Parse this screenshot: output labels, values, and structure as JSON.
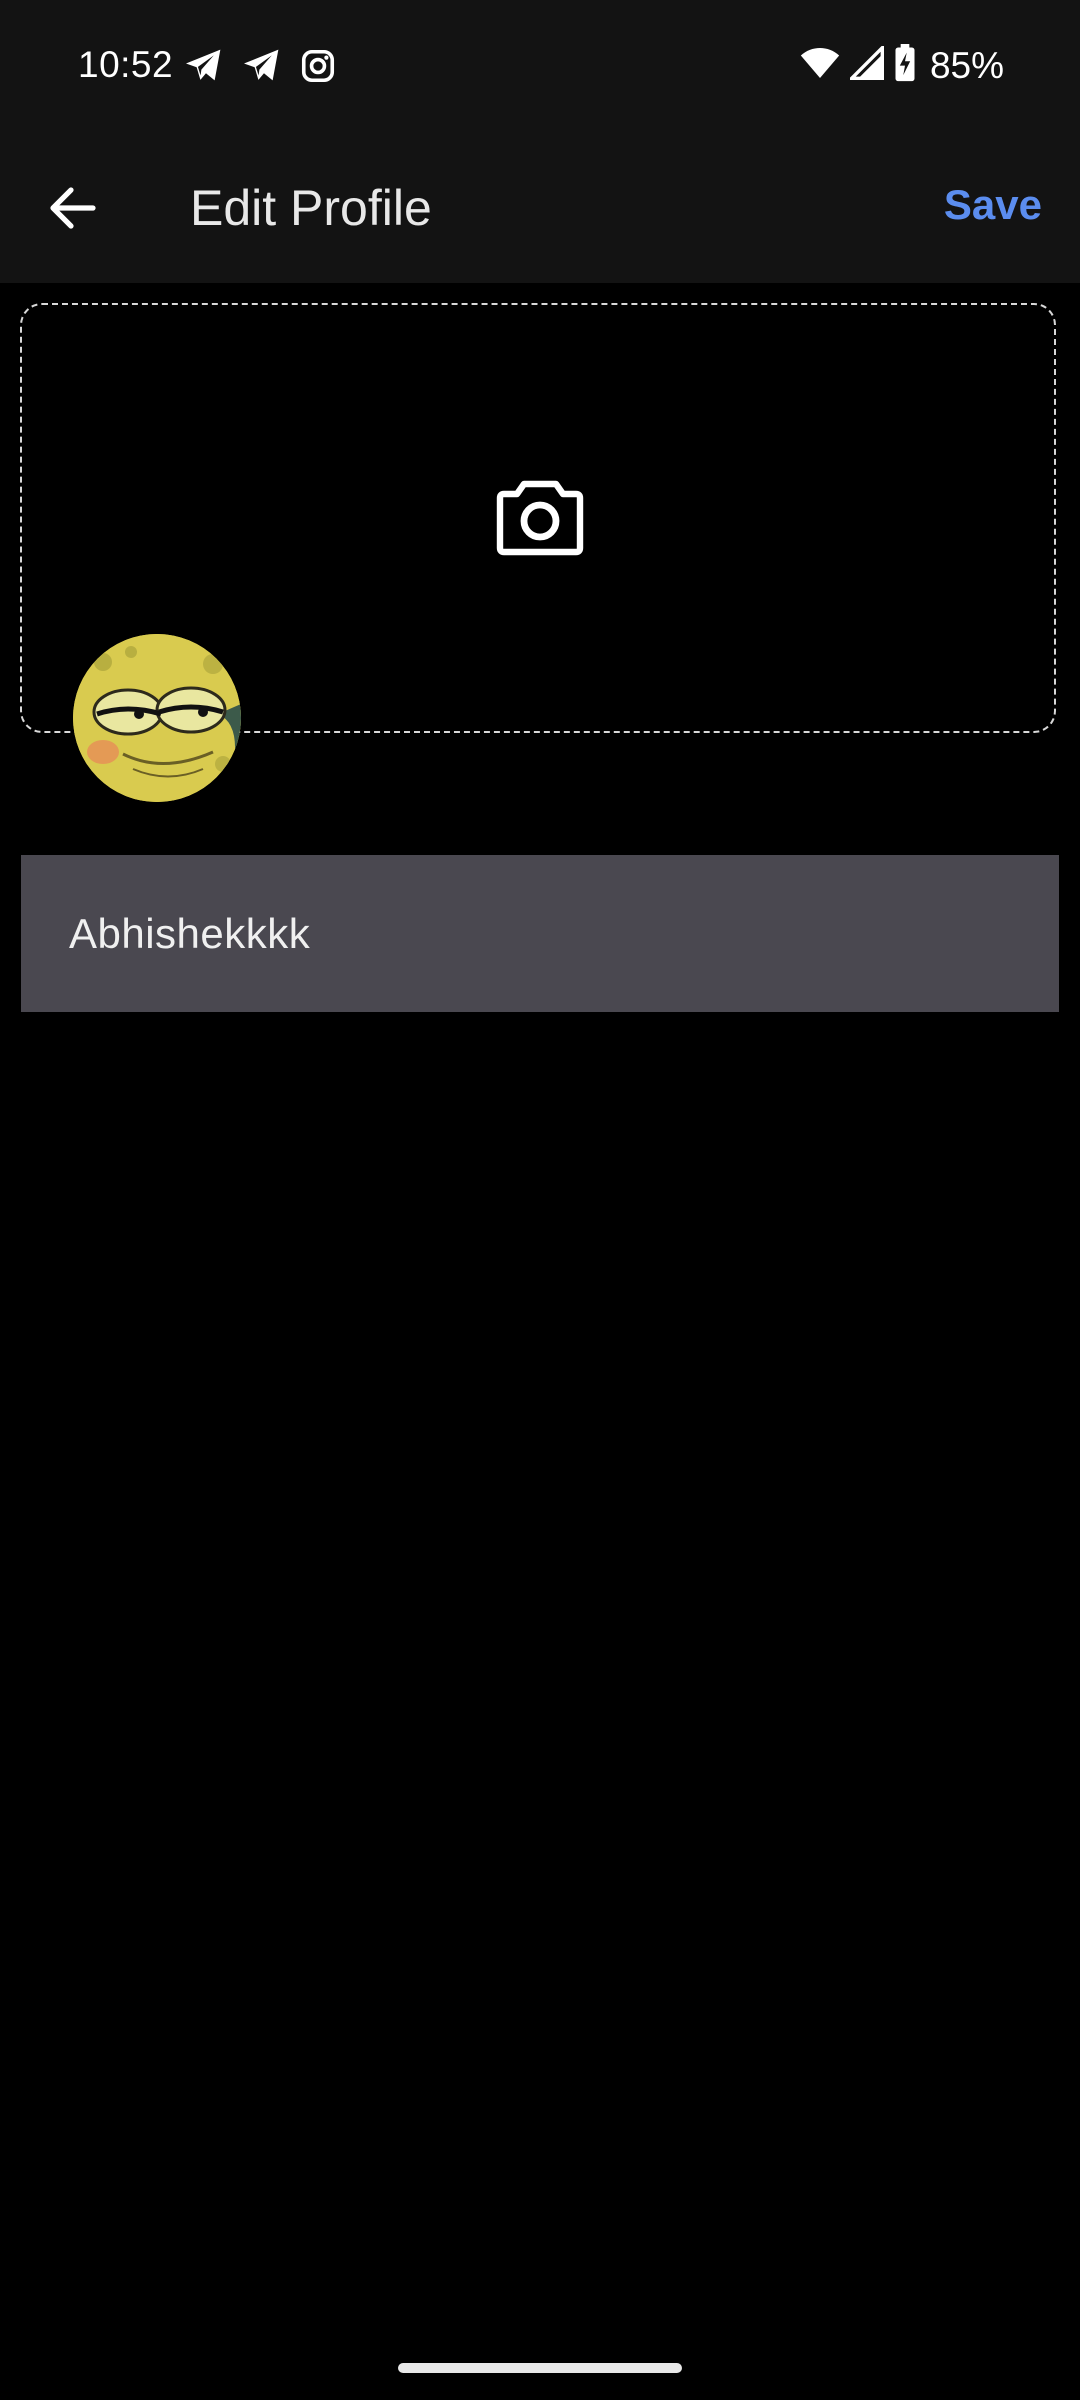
{
  "status_bar": {
    "time": "10:52",
    "battery": "85%",
    "left_icons": [
      "telegram-icon",
      "telegram-icon",
      "instagram-icon"
    ],
    "right_icons": [
      "wifi-icon",
      "signal-icon",
      "battery-charging-icon"
    ]
  },
  "app_bar": {
    "title": "Edit Profile",
    "save_label": "Save",
    "back_icon": "arrow-left-icon"
  },
  "cover": {
    "icon": "camera-icon"
  },
  "profile": {
    "name_value": "Abhishekkkk"
  },
  "colors": {
    "accent": "#5b8def",
    "bar_background": "#131313",
    "field_background": "#4a4850",
    "page_background": "#000000"
  }
}
